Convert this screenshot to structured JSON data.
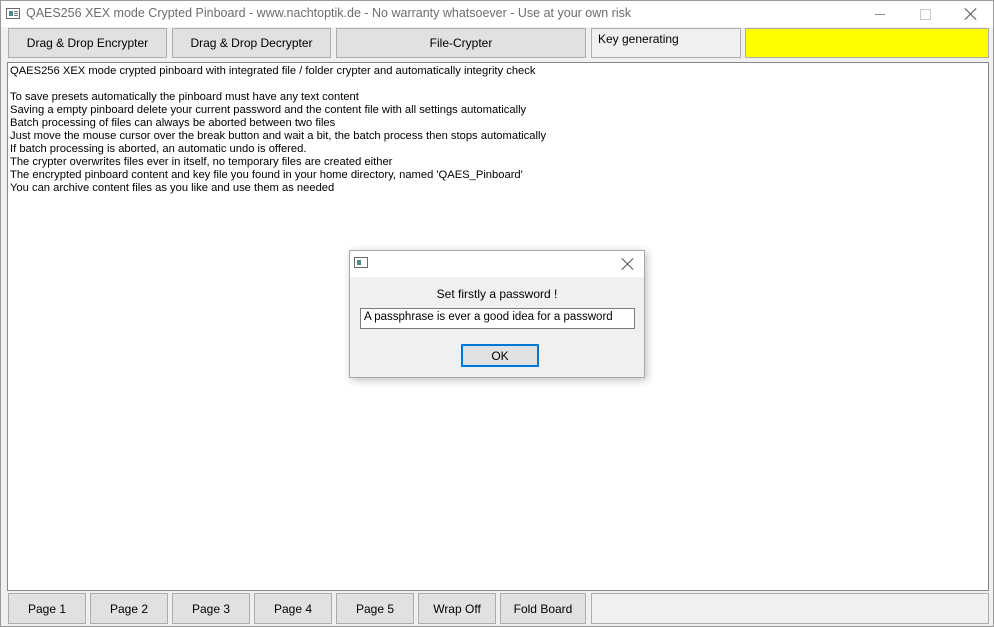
{
  "window": {
    "title": "QAES256 XEX mode Crypted Pinboard - www.nachtoptik.de - No warranty whatsoever - Use at your own risk"
  },
  "toolbar": {
    "encrypter_label": "Drag & Drop Encrypter",
    "decrypter_label": "Drag & Drop Decrypter",
    "file_crypter_label": "File-Crypter",
    "key_status_text": "Key generating",
    "indicator_color": "#ffff00"
  },
  "pinboard": {
    "lines": [
      "QAES256 XEX mode crypted pinboard with integrated file / folder crypter and automatically integrity check",
      "",
      "To save presets automatically the pinboard must have any text content",
      "Saving a empty pinboard delete your current password and the content file with all settings automatically",
      "Batch processing of files can always be aborted between two files",
      "Just move the mouse cursor over the break button and wait a bit, the batch process then stops automatically",
      "If batch processing is aborted, an automatic undo is offered.",
      "The crypter overwrites files ever in itself, no temporary files are created either",
      "The encrypted pinboard content and key file you found in your home directory, named 'QAES_Pinboard'",
      "You can archive content files as you like and use them as needed"
    ]
  },
  "bottombar": {
    "page1": "Page 1",
    "page2": "Page 2",
    "page3": "Page 3",
    "page4": "Page 4",
    "page5": "Page 5",
    "wrap": "Wrap Off",
    "fold": "Fold Board"
  },
  "dialog": {
    "message": "Set firstly a password !",
    "input_value": "A passphrase is ever a good idea for a password",
    "ok_label": "OK"
  }
}
